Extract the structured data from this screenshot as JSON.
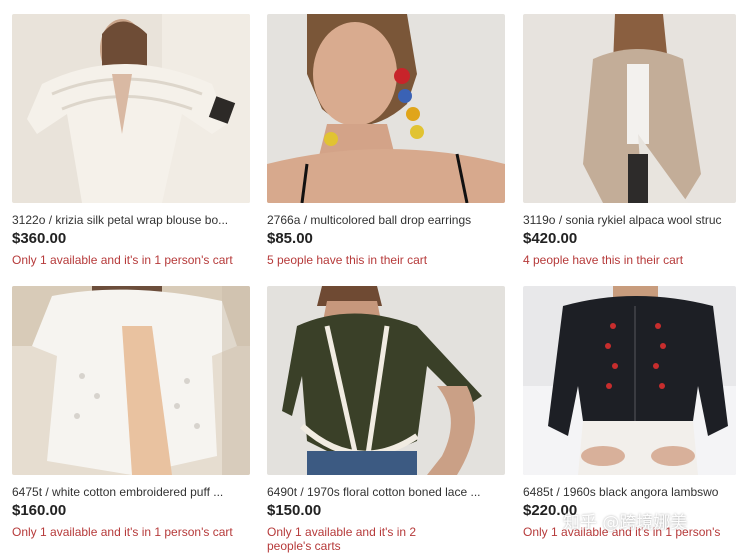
{
  "products": [
    {
      "title": "3122o / krizia silk petal wrap blouse bo...",
      "price": "$360.00",
      "status": "Only 1 available and it's in 1 person's cart",
      "image": "cream-ruffle-blouse-photo"
    },
    {
      "title": "2766a / multicolored ball drop earrings",
      "price": "$85.00",
      "status": "5 people have this in their cart",
      "image": "ball-drop-earrings-photo"
    },
    {
      "title": "3119o / sonia rykiel alpaca wool struc",
      "price": "$420.00",
      "status": "4 people have this in their cart",
      "image": "camel-coat-photo"
    },
    {
      "title": "6475t / white cotton embroidered puff ...",
      "price": "$160.00",
      "status": "Only 1 available and it's in 1 person's cart",
      "image": "white-eyelet-top-photo"
    },
    {
      "title": "6490t / 1970s floral cotton boned lace ...",
      "price": "$150.00",
      "status": "Only 1 available and it's in 2 people's carts",
      "image": "floral-bodice-photo"
    },
    {
      "title": "6485t / 1960s black angora lambswo",
      "price": "$220.00",
      "status": "Only 1 available and it's in 1 person's",
      "image": "black-cardigan-photo"
    }
  ],
  "watermark": "知乎 @跨境娜美"
}
